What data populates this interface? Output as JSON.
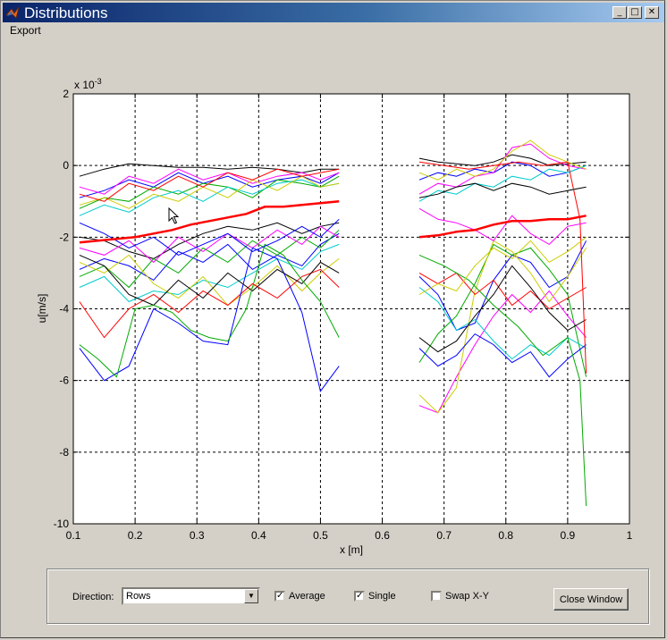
{
  "window": {
    "title": "Distributions",
    "minimize_glyph": "_",
    "maximize_glyph": "□",
    "close_glyph": "✕"
  },
  "menu": {
    "export_label": "Export"
  },
  "controls": {
    "direction_label": "Direction:",
    "direction_value": "Rows",
    "direction_arrow": "▼",
    "average_label": "Average",
    "average_checked": true,
    "single_label": "Single",
    "single_checked": true,
    "swap_label": "Swap X-Y",
    "swap_checked": false,
    "check_glyph": "✓",
    "close_window_label": "Close Window"
  },
  "chart_data": {
    "type": "line",
    "xlabel": "x [m]",
    "ylabel": "u[m/s]",
    "y_multiplier": "x 10",
    "y_multiplier_exponent": "-3",
    "xlim": [
      0.1,
      1.0
    ],
    "ylim": [
      -10,
      2
    ],
    "x_ticks": [
      0.1,
      0.2,
      0.3,
      0.4,
      0.5,
      0.6,
      0.7,
      0.8,
      0.9,
      1.0
    ],
    "x_tick_labels": [
      "0.1",
      "0.2",
      "0.3",
      "0.4",
      "0.5",
      "0.6",
      "0.7",
      "0.8",
      "0.9",
      "1"
    ],
    "y_ticks": [
      -10,
      -8,
      -6,
      -4,
      -2,
      0,
      2
    ],
    "y_tick_labels": [
      "-10",
      "-8",
      "-6",
      "-4",
      "-2",
      "0",
      "2"
    ],
    "grid": true,
    "colors": {
      "axes_bg": "#ffffff",
      "figure_bg": "#d4d0c8",
      "average": "#ff0000"
    },
    "average_series": [
      {
        "x": [
          0.11,
          0.14,
          0.17,
          0.2,
          0.23,
          0.26,
          0.29,
          0.32,
          0.35,
          0.38,
          0.41,
          0.44,
          0.47,
          0.5,
          0.53
        ],
        "y": [
          -2.15,
          -2.1,
          -2.05,
          -2.0,
          -1.9,
          -1.8,
          -1.65,
          -1.55,
          -1.45,
          -1.35,
          -1.15,
          -1.15,
          -1.1,
          -1.05,
          -1.0
        ]
      },
      {
        "x": [
          0.66,
          0.69,
          0.72,
          0.75,
          0.78,
          0.81,
          0.84,
          0.87,
          0.9,
          0.93
        ],
        "y": [
          -2.0,
          -1.95,
          -1.85,
          -1.8,
          -1.65,
          -1.55,
          -1.55,
          -1.5,
          -1.5,
          -1.4
        ]
      }
    ],
    "single_series": [
      {
        "color": "#000000",
        "x": [
          0.11,
          0.15,
          0.19,
          0.23,
          0.27,
          0.31,
          0.35,
          0.39,
          0.43,
          0.47,
          0.5,
          0.53
        ],
        "y": [
          -0.3,
          -0.1,
          0.05,
          0.0,
          -0.05,
          -0.05,
          -0.1,
          -0.05,
          -0.1,
          -0.2,
          -0.1,
          -0.1
        ]
      },
      {
        "color": "#0000ff",
        "x": [
          0.11,
          0.15,
          0.19,
          0.23,
          0.27,
          0.31,
          0.35,
          0.39,
          0.43,
          0.47,
          0.5,
          0.53
        ],
        "y": [
          -0.9,
          -0.7,
          -0.4,
          -0.6,
          -0.2,
          -0.5,
          -0.3,
          -0.6,
          -0.4,
          -0.3,
          -0.5,
          -0.2
        ]
      },
      {
        "color": "#00aa00",
        "x": [
          0.11,
          0.15,
          0.19,
          0.23,
          0.27,
          0.31,
          0.35,
          0.39,
          0.43,
          0.47,
          0.5,
          0.53
        ],
        "y": [
          -1.2,
          -0.9,
          -1.0,
          -0.6,
          -0.8,
          -0.5,
          -0.6,
          -0.9,
          -0.4,
          -0.5,
          -0.6,
          -0.3
        ]
      },
      {
        "color": "#ff00ff",
        "x": [
          0.11,
          0.15,
          0.19,
          0.23,
          0.27,
          0.31,
          0.35,
          0.39,
          0.43,
          0.47,
          0.5,
          0.53
        ],
        "y": [
          -0.6,
          -0.8,
          -0.3,
          -0.5,
          -0.1,
          -0.4,
          -0.2,
          -0.5,
          -0.3,
          -0.2,
          -0.4,
          -0.2
        ]
      },
      {
        "color": "#00cccc",
        "x": [
          0.11,
          0.15,
          0.19,
          0.23,
          0.27,
          0.31,
          0.35,
          0.39,
          0.43,
          0.47,
          0.5,
          0.53
        ],
        "y": [
          -1.4,
          -1.1,
          -1.3,
          -0.9,
          -0.7,
          -1.0,
          -0.6,
          -0.8,
          -0.5,
          -0.4,
          -0.6,
          -0.5
        ]
      },
      {
        "color": "#cccc00",
        "x": [
          0.11,
          0.15,
          0.19,
          0.23,
          0.27,
          0.31,
          0.35,
          0.39,
          0.43,
          0.47,
          0.5,
          0.53
        ],
        "y": [
          -1.1,
          -0.9,
          -1.2,
          -0.8,
          -1.0,
          -0.6,
          -0.9,
          -0.4,
          -0.7,
          -0.3,
          -0.6,
          -0.5
        ]
      },
      {
        "color": "#ff0000",
        "x": [
          0.11,
          0.15,
          0.19,
          0.23,
          0.27,
          0.31,
          0.35,
          0.39,
          0.43,
          0.47,
          0.5,
          0.53
        ],
        "y": [
          -0.8,
          -1.0,
          -0.5,
          -0.7,
          -0.3,
          -0.6,
          -0.2,
          -0.4,
          -0.1,
          -0.3,
          -0.2,
          -0.1
        ]
      },
      {
        "color": "#000000",
        "x": [
          0.11,
          0.15,
          0.19,
          0.23,
          0.27,
          0.31,
          0.35,
          0.39,
          0.43,
          0.47,
          0.5,
          0.53
        ],
        "y": [
          -2.0,
          -2.1,
          -2.4,
          -2.6,
          -2.2,
          -1.9,
          -1.7,
          -1.8,
          -1.6,
          -1.9,
          -1.7,
          -1.6
        ]
      },
      {
        "color": "#0000ff",
        "x": [
          0.11,
          0.15,
          0.19,
          0.23,
          0.27,
          0.31,
          0.35,
          0.39,
          0.43,
          0.47,
          0.5,
          0.53
        ],
        "y": [
          -2.9,
          -2.6,
          -2.8,
          -3.2,
          -2.4,
          -2.7,
          -2.2,
          -2.9,
          -2.5,
          -2.8,
          -2.2,
          -1.9
        ]
      },
      {
        "color": "#00aa00",
        "x": [
          0.11,
          0.15,
          0.19,
          0.23,
          0.27,
          0.31,
          0.35,
          0.39,
          0.43,
          0.47,
          0.5,
          0.53
        ],
        "y": [
          -3.1,
          -2.8,
          -3.4,
          -2.6,
          -3.0,
          -2.3,
          -2.7,
          -2.1,
          -2.5,
          -2.0,
          -2.3,
          -1.8
        ]
      },
      {
        "color": "#ff00ff",
        "x": [
          0.11,
          0.15,
          0.19,
          0.23,
          0.27,
          0.31,
          0.35,
          0.39,
          0.43,
          0.47,
          0.5,
          0.53
        ],
        "y": [
          -2.3,
          -2.5,
          -2.1,
          -2.7,
          -2.0,
          -2.4,
          -1.9,
          -2.3,
          -1.8,
          -2.2,
          -1.7,
          -2.0
        ]
      },
      {
        "color": "#00cccc",
        "x": [
          0.11,
          0.15,
          0.19,
          0.23,
          0.27,
          0.31,
          0.35,
          0.39,
          0.43,
          0.47,
          0.5,
          0.53
        ],
        "y": [
          -3.4,
          -3.1,
          -3.8,
          -3.5,
          -3.6,
          -3.2,
          -3.4,
          -3.0,
          -2.6,
          -2.9,
          -2.4,
          -2.2
        ]
      },
      {
        "color": "#cccc00",
        "x": [
          0.11,
          0.15,
          0.19,
          0.23,
          0.27,
          0.31,
          0.35,
          0.39,
          0.43,
          0.47,
          0.5,
          0.53
        ],
        "y": [
          -2.7,
          -3.0,
          -2.5,
          -3.3,
          -3.7,
          -3.1,
          -3.9,
          -3.4,
          -2.8,
          -3.5,
          -3.0,
          -2.6
        ]
      },
      {
        "color": "#ff0000",
        "x": [
          0.11,
          0.15,
          0.19,
          0.23,
          0.27,
          0.31,
          0.35,
          0.39,
          0.43,
          0.47,
          0.5,
          0.53
        ],
        "y": [
          -3.8,
          -4.8,
          -4.0,
          -3.6,
          -4.1,
          -3.5,
          -3.9,
          -3.3,
          -3.7,
          -3.1,
          -2.9,
          -3.4
        ]
      },
      {
        "color": "#000000",
        "x": [
          0.11,
          0.15,
          0.19,
          0.23,
          0.27,
          0.31,
          0.35,
          0.39,
          0.43,
          0.47,
          0.5,
          0.53
        ],
        "y": [
          -2.5,
          -2.8,
          -3.6,
          -3.9,
          -3.2,
          -3.7,
          -3.0,
          -3.5,
          -2.9,
          -3.3,
          -2.7,
          -3.0
        ]
      },
      {
        "color": "#0000ff",
        "x": [
          0.11,
          0.15,
          0.19,
          0.23,
          0.27,
          0.31,
          0.35,
          0.39,
          0.43,
          0.47,
          0.5,
          0.53
        ],
        "y": [
          -5.1,
          -6.0,
          -5.6,
          -4.0,
          -4.4,
          -4.9,
          -5.0,
          -2.3,
          -2.6,
          -4.1,
          -6.3,
          -5.6
        ]
      },
      {
        "color": "#00aa00",
        "x": [
          0.11,
          0.14,
          0.17,
          0.2,
          0.23,
          0.26,
          0.29,
          0.32,
          0.35,
          0.38,
          0.41,
          0.44,
          0.47,
          0.5,
          0.53
        ],
        "y": [
          -5.0,
          -5.4,
          -5.9,
          -4.0,
          -3.9,
          -4.1,
          -4.6,
          -4.8,
          -4.9,
          -4.0,
          -2.2,
          -2.5,
          -3.2,
          -3.8,
          -4.8
        ]
      },
      {
        "color": "#0000ff",
        "x": [
          0.11,
          0.15,
          0.19,
          0.23,
          0.27,
          0.31,
          0.35,
          0.39,
          0.43,
          0.47,
          0.5,
          0.53
        ],
        "y": [
          -1.6,
          -1.9,
          -2.3,
          -2.0,
          -2.5,
          -2.2,
          -1.9,
          -2.4,
          -2.1,
          -1.7,
          -2.0,
          -1.5
        ]
      },
      {
        "color": "#000000",
        "x": [
          0.66,
          0.69,
          0.72,
          0.75,
          0.78,
          0.81,
          0.84,
          0.87,
          0.9,
          0.93
        ],
        "y": [
          0.2,
          0.1,
          0.05,
          0.0,
          0.1,
          0.3,
          0.2,
          0.0,
          0.05,
          0.1
        ]
      },
      {
        "color": "#0000ff",
        "x": [
          0.66,
          0.69,
          0.72,
          0.75,
          0.78,
          0.81,
          0.84,
          0.87,
          0.9,
          0.93
        ],
        "y": [
          -0.4,
          -0.2,
          -0.3,
          -0.1,
          -0.2,
          0.1,
          0.0,
          -0.3,
          -0.2,
          0.0
        ]
      },
      {
        "color": "#ff00ff",
        "x": [
          0.66,
          0.69,
          0.72,
          0.75,
          0.78,
          0.81,
          0.84,
          0.87,
          0.9,
          0.93
        ],
        "y": [
          -0.8,
          -0.5,
          -0.6,
          -0.3,
          -0.2,
          0.5,
          0.6,
          0.2,
          0.0,
          -0.1
        ]
      },
      {
        "color": "#00cccc",
        "x": [
          0.66,
          0.69,
          0.72,
          0.75,
          0.78,
          0.81,
          0.84,
          0.87,
          0.9,
          0.93
        ],
        "y": [
          -1.0,
          -0.7,
          -0.8,
          -0.5,
          -0.6,
          -0.3,
          -0.4,
          -0.1,
          -0.2,
          0.0
        ]
      },
      {
        "color": "#cccc00",
        "x": [
          0.66,
          0.69,
          0.72,
          0.75,
          0.78,
          0.81,
          0.84,
          0.87,
          0.9,
          0.93
        ],
        "y": [
          -0.2,
          -0.4,
          -0.1,
          -0.3,
          -0.1,
          0.4,
          0.7,
          0.3,
          0.1,
          -0.1
        ]
      },
      {
        "color": "#000000",
        "x": [
          0.66,
          0.69,
          0.72,
          0.75,
          0.78,
          0.81,
          0.84,
          0.87,
          0.9,
          0.93
        ],
        "y": [
          -0.9,
          -0.8,
          -0.6,
          -0.5,
          -0.7,
          -0.5,
          -0.6,
          -0.8,
          -0.7,
          -0.6
        ]
      },
      {
        "color": "#0000ff",
        "x": [
          0.66,
          0.69,
          0.72,
          0.75,
          0.78,
          0.81,
          0.84,
          0.87,
          0.9,
          0.93
        ],
        "y": [
          -3.1,
          -3.6,
          -4.6,
          -4.4,
          -3.2,
          -2.5,
          -2.7,
          -3.4,
          -3.1,
          -2.1
        ]
      },
      {
        "color": "#00aa00",
        "x": [
          0.66,
          0.69,
          0.72,
          0.75,
          0.78,
          0.81,
          0.84,
          0.87,
          0.9,
          0.93
        ],
        "y": [
          -5.5,
          -4.7,
          -4.2,
          -3.3,
          -2.2,
          -2.5,
          -2.3,
          -2.9,
          -3.6,
          -5.9
        ]
      },
      {
        "color": "#ff00ff",
        "x": [
          0.66,
          0.69,
          0.72,
          0.75,
          0.78,
          0.81,
          0.84,
          0.87,
          0.9,
          0.93
        ],
        "y": [
          -6.7,
          -6.9,
          -5.9,
          -5.0,
          -4.2,
          -3.6,
          -4.1,
          -3.5,
          -4.2,
          -4.8
        ]
      },
      {
        "color": "#cccc00",
        "x": [
          0.66,
          0.69,
          0.72,
          0.75,
          0.78,
          0.81,
          0.84,
          0.87,
          0.9,
          0.93
        ],
        "y": [
          -6.4,
          -6.9,
          -6.2,
          -3.5,
          -2.1,
          -2.4,
          -3.0,
          -3.8,
          -3.1,
          -2.3
        ]
      },
      {
        "color": "#00cccc",
        "x": [
          0.66,
          0.69,
          0.72,
          0.75,
          0.78,
          0.81,
          0.84,
          0.87,
          0.9,
          0.93
        ],
        "y": [
          -3.4,
          -3.8,
          -4.6,
          -4.3,
          -4.9,
          -5.4,
          -5.0,
          -5.3,
          -4.8,
          -5.1
        ]
      },
      {
        "color": "#ff0000",
        "x": [
          0.66,
          0.69,
          0.72,
          0.75,
          0.78,
          0.81,
          0.84,
          0.87,
          0.9,
          0.93
        ],
        "y": [
          -3.0,
          -3.3,
          -3.0,
          -3.6,
          -3.2,
          -3.9,
          -3.5,
          -4.0,
          -3.7,
          -3.4
        ]
      },
      {
        "color": "#0000ff",
        "x": [
          0.66,
          0.69,
          0.72,
          0.75,
          0.78,
          0.81,
          0.84,
          0.87,
          0.9,
          0.93
        ],
        "y": [
          -5.1,
          -5.6,
          -5.3,
          -4.7,
          -5.0,
          -5.5,
          -5.2,
          -5.9,
          -5.4,
          -5.0
        ]
      },
      {
        "color": "#000000",
        "x": [
          0.66,
          0.69,
          0.72,
          0.75,
          0.78,
          0.81,
          0.84,
          0.87,
          0.9,
          0.93
        ],
        "y": [
          -4.8,
          -5.2,
          -4.9,
          -4.2,
          -3.6,
          -2.8,
          -3.4,
          -4.1,
          -4.6,
          -4.3
        ]
      },
      {
        "color": "#00aa00",
        "x": [
          0.66,
          0.7,
          0.74,
          0.78,
          0.82,
          0.86,
          0.9,
          0.92,
          0.93
        ],
        "y": [
          -2.5,
          -2.8,
          -3.2,
          -3.9,
          -4.5,
          -5.3,
          -4.8,
          -6.0,
          -9.5
        ]
      },
      {
        "color": "#ff0000",
        "x": [
          0.66,
          0.7,
          0.74,
          0.78,
          0.82,
          0.86,
          0.9,
          0.92,
          0.93
        ],
        "y": [
          0.1,
          0.0,
          -0.1,
          0.0,
          0.1,
          0.0,
          0.1,
          -1.5,
          -5.8
        ]
      },
      {
        "color": "#cccc00",
        "x": [
          0.66,
          0.69,
          0.72,
          0.75,
          0.78,
          0.81,
          0.84,
          0.87,
          0.9,
          0.93
        ],
        "y": [
          -3.6,
          -3.3,
          -3.5,
          -2.8,
          -2.3,
          -2.6,
          -2.1,
          -2.7,
          -2.4,
          -2.0
        ]
      },
      {
        "color": "#ff00ff",
        "x": [
          0.66,
          0.69,
          0.72,
          0.75,
          0.78,
          0.81,
          0.84,
          0.87,
          0.9,
          0.93
        ],
        "y": [
          -1.2,
          -1.5,
          -1.6,
          -1.8,
          -2.1,
          -1.4,
          -1.9,
          -2.2,
          -1.7,
          -1.6
        ]
      }
    ]
  }
}
